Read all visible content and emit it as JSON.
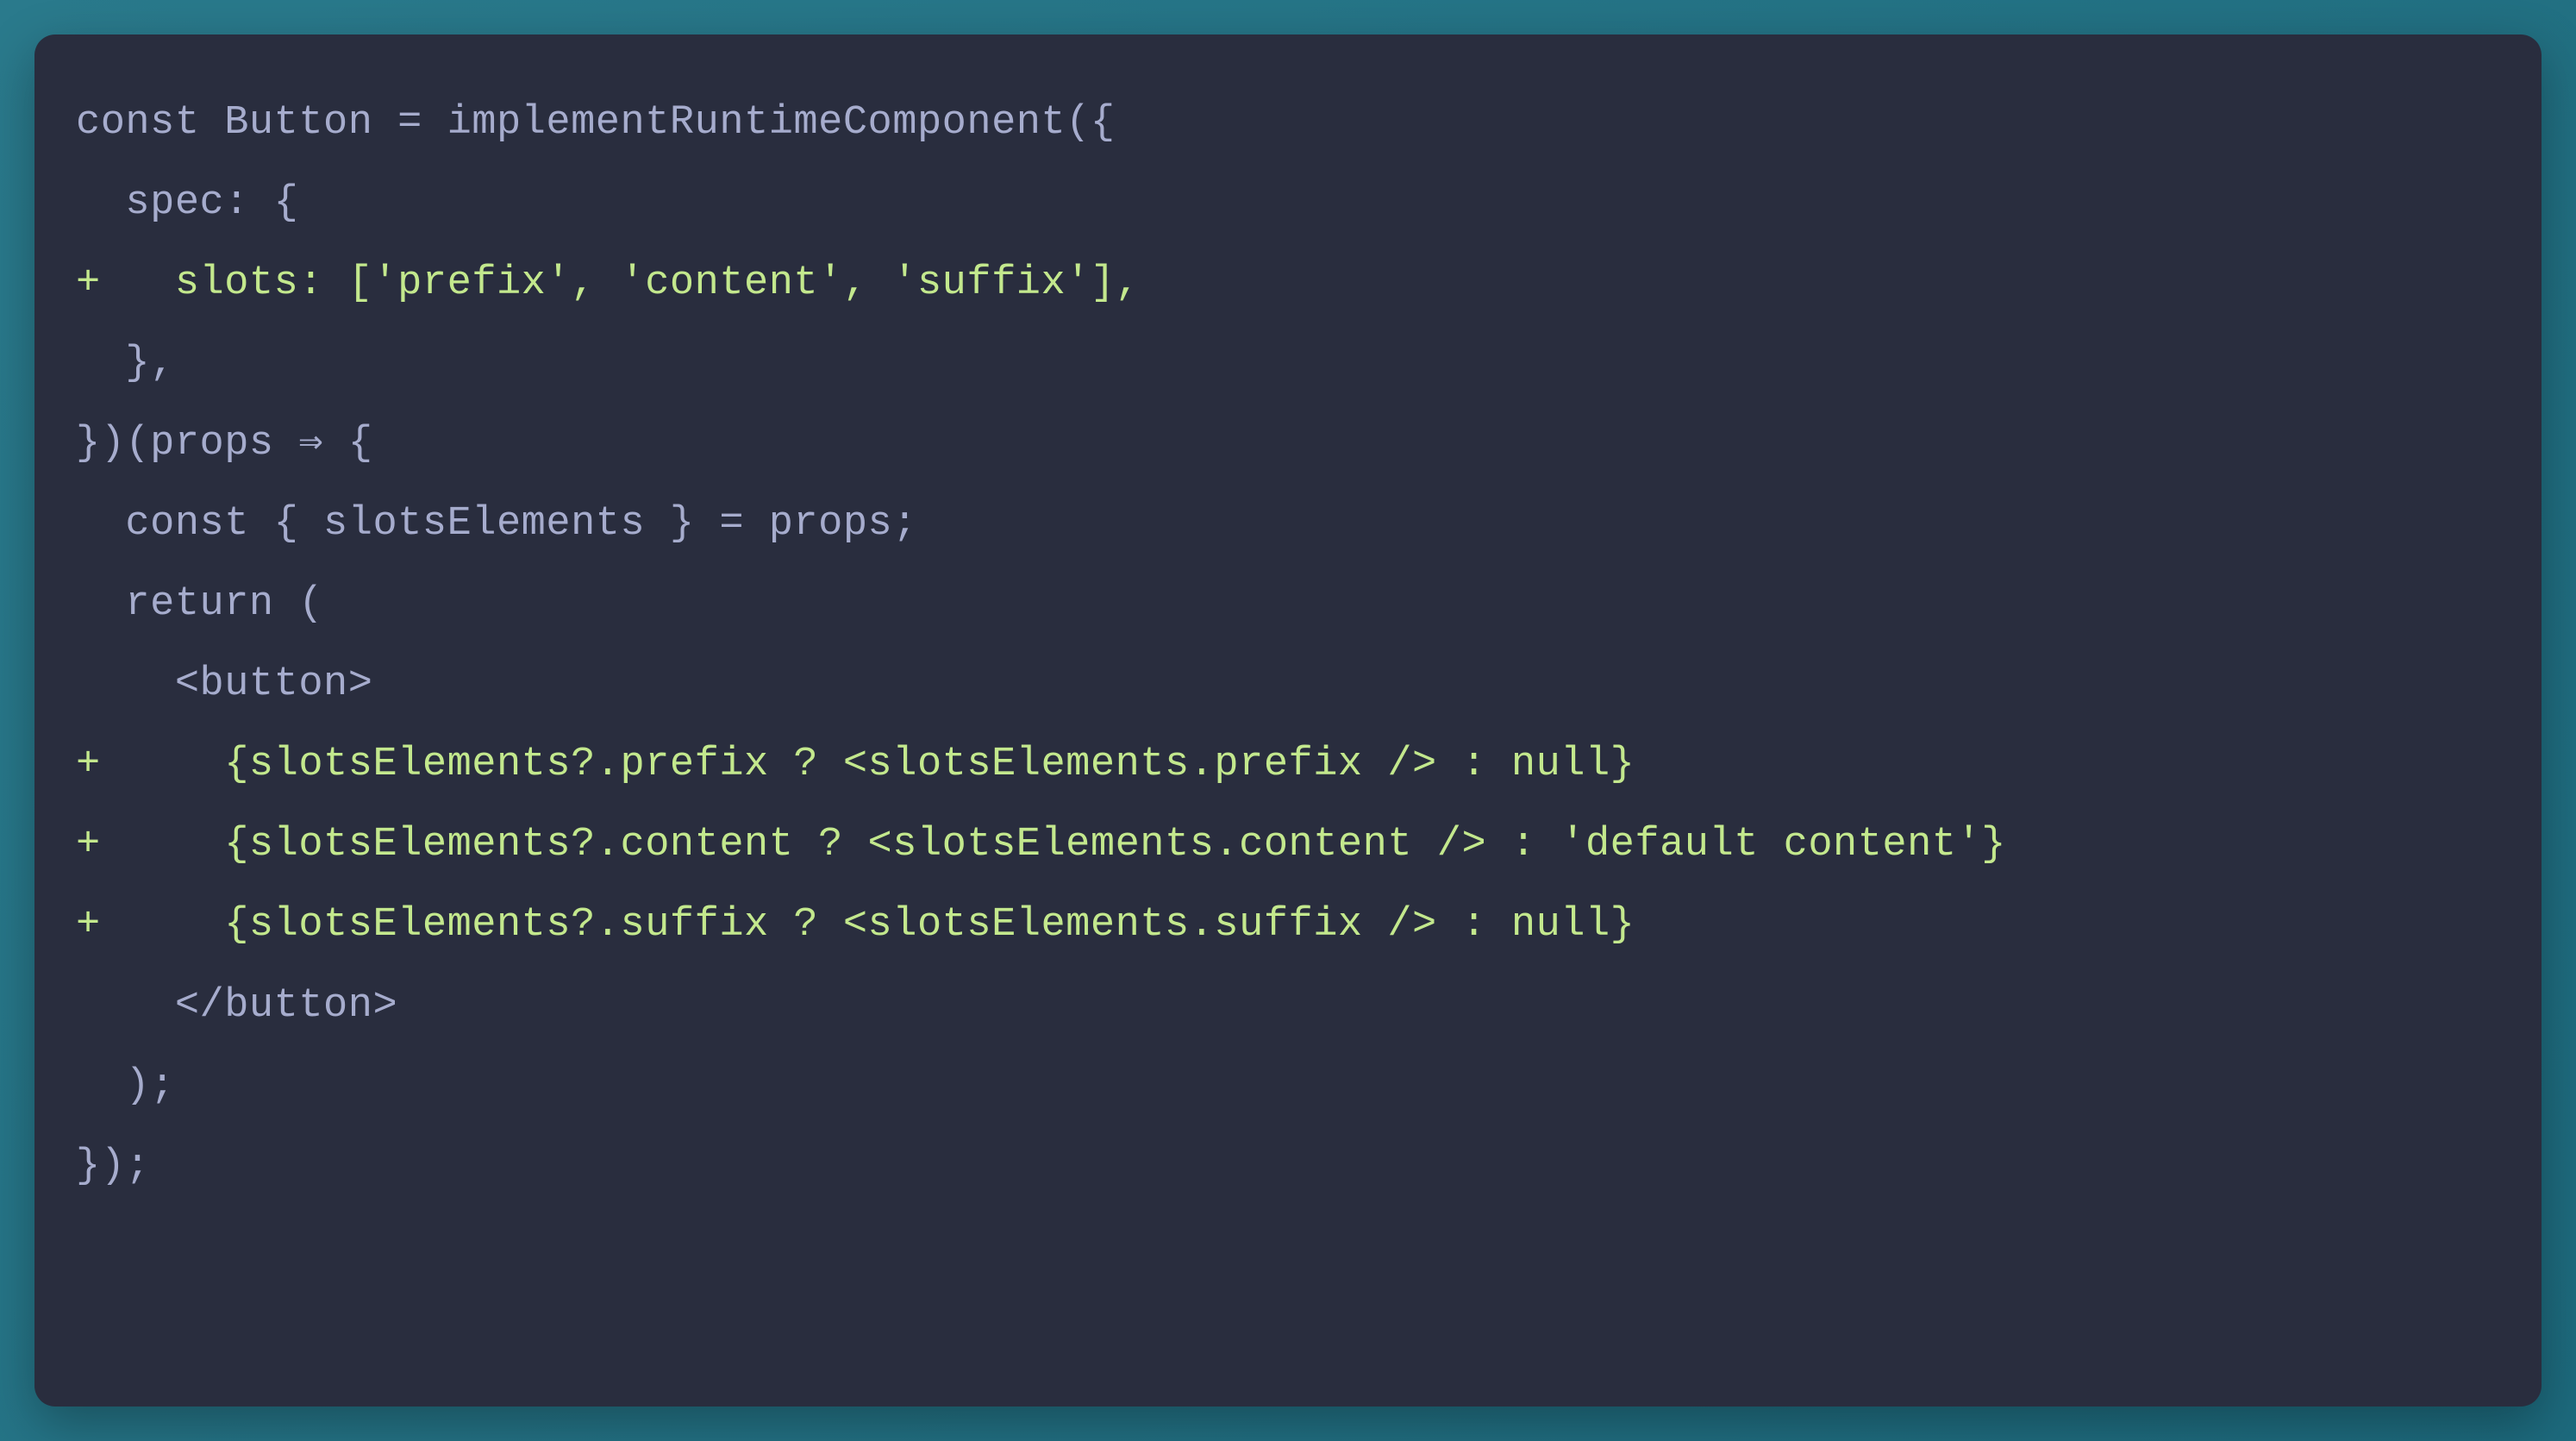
{
  "code": {
    "lines": [
      {
        "diff": false,
        "text": "const Button = implementRuntimeComponent({"
      },
      {
        "diff": false,
        "text": "  spec: {"
      },
      {
        "diff": true,
        "text": "+   slots: ['prefix', 'content', 'suffix'],"
      },
      {
        "diff": false,
        "text": "  },"
      },
      {
        "diff": false,
        "text": "})(props ⇒ {"
      },
      {
        "diff": false,
        "text": "  const { slotsElements } = props;"
      },
      {
        "diff": false,
        "text": ""
      },
      {
        "diff": false,
        "text": "  return ("
      },
      {
        "diff": false,
        "text": "    <button>"
      },
      {
        "diff": true,
        "text": "+     {slotsElements?.prefix ? <slotsElements.prefix /> : null}"
      },
      {
        "diff": true,
        "text": "+     {slotsElements?.content ? <slotsElements.content /> : 'default content'}"
      },
      {
        "diff": true,
        "text": "+     {slotsElements?.suffix ? <slotsElements.suffix /> : null}"
      },
      {
        "diff": false,
        "text": "    </button>"
      },
      {
        "diff": false,
        "text": "  );"
      },
      {
        "diff": false,
        "text": "});"
      }
    ]
  }
}
